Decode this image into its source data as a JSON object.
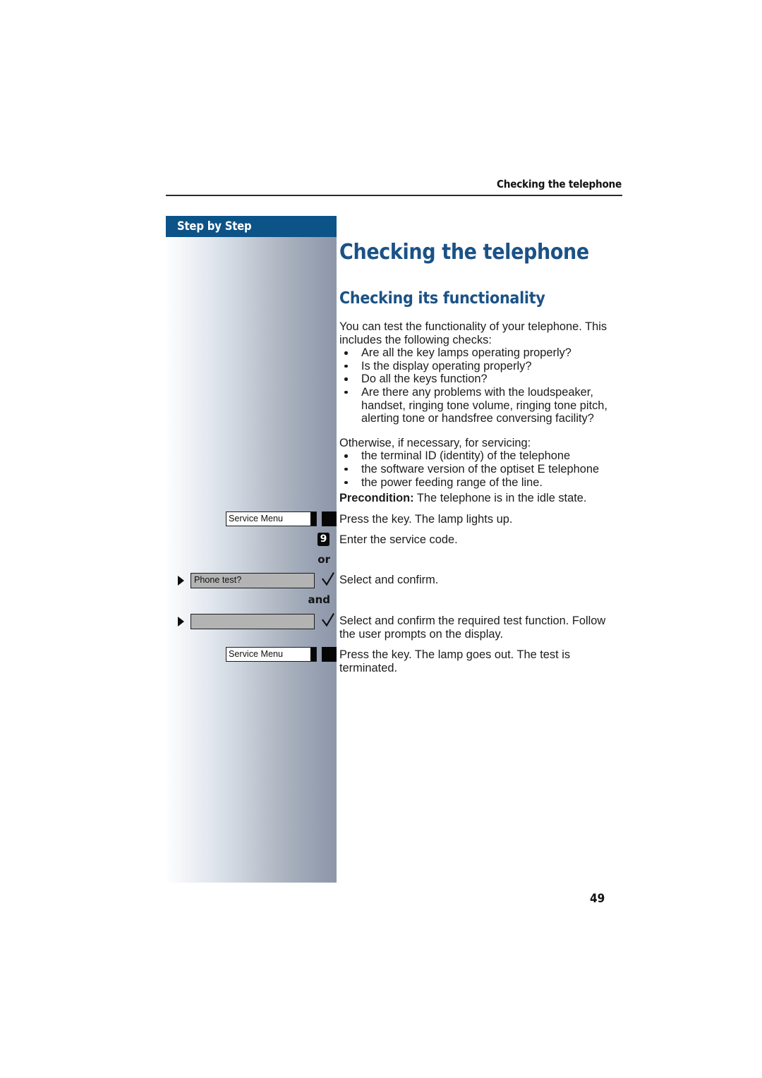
{
  "header": {
    "running_title": "Checking the telephone"
  },
  "sidebar": {
    "band_label": "Step by Step"
  },
  "main": {
    "title": "Checking the telephone",
    "subtitle": "Checking its functionality",
    "intro": "You can test the functionality of your telephone. This includes the following checks:",
    "checks": [
      "Are all the key lamps operating properly?",
      "Is the display operating properly?",
      "Do all the keys function?",
      "Are there any problems with the loudspeaker, handset, ringing tone volume, ringing tone pitch, alerting tone or handsfree conversing facility?"
    ],
    "servicing_intro": "Otherwise, if necessary, for servicing:",
    "servicing_items": [
      "the terminal ID (identity) of the telephone",
      "the software version of the optiset E telephone",
      "the power feeding range of the line."
    ],
    "precondition_label": "Precondition:",
    "precondition_text": " The telephone is in the idle state."
  },
  "steps": [
    {
      "key_label": "Service Menu",
      "instruction": "Press the key. The lamp lights up."
    },
    {
      "key_digit": "9",
      "instruction": "Enter the service code."
    },
    {
      "connector": "or"
    },
    {
      "display_text": "Phone test?",
      "instruction": "Select and confirm."
    },
    {
      "connector": "and"
    },
    {
      "display_text": "",
      "instruction": "Select and confirm the required test function. Follow the user prompts on the display."
    },
    {
      "key_label": "Service Menu",
      "instruction": "Press the key. The lamp goes out. The test is terminated."
    }
  ],
  "footer": {
    "page_number": "49"
  },
  "colors": {
    "accent_blue": "#1b5286",
    "band_blue": "#0c5388",
    "body_text": "#1c1c1c",
    "display_field": "#b3b3b3"
  }
}
